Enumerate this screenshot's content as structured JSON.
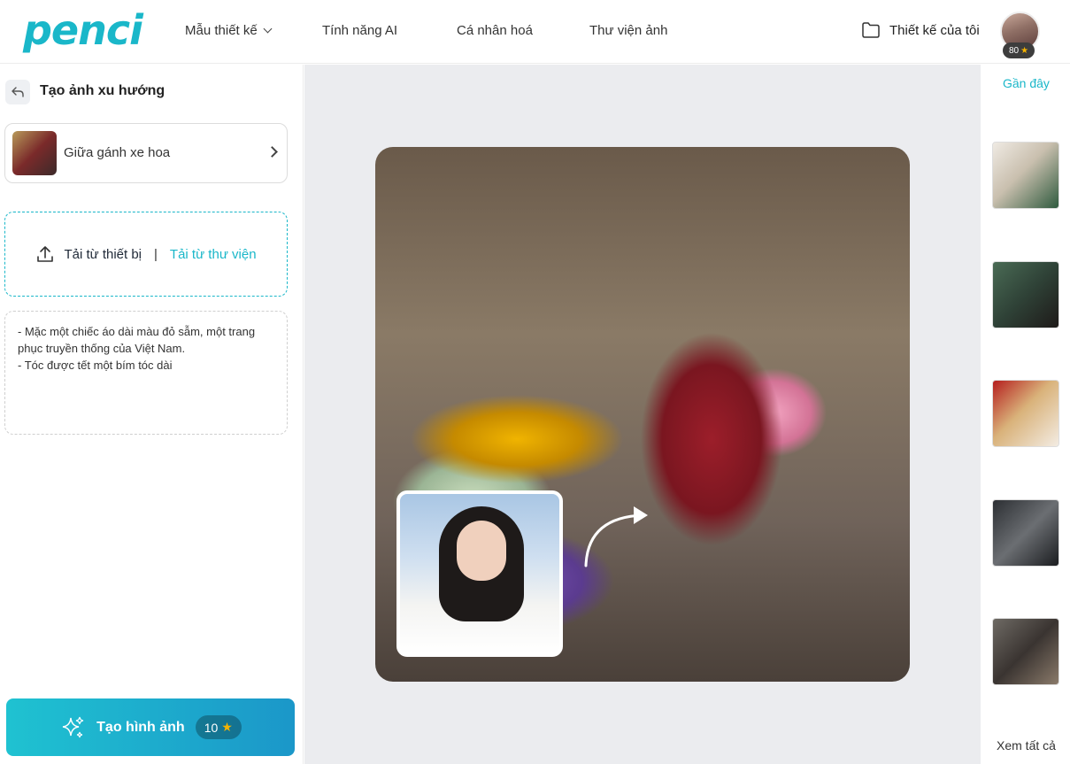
{
  "header": {
    "logo": "penci",
    "nav": [
      {
        "label": "Mẫu thiết kế",
        "has_dropdown": true
      },
      {
        "label": "Tính năng AI"
      },
      {
        "label": "Cá nhân hoá"
      },
      {
        "label": "Thư viện ảnh"
      }
    ],
    "my_designs_label": "Thiết kế của tôi",
    "credits": "80"
  },
  "left_panel": {
    "title": "Tạo ảnh xu hướng",
    "template_name": "Giữa gánh xe hoa",
    "upload_device_label": "Tải từ thiết bị",
    "upload_separator": "|",
    "upload_library_label": "Tải từ thư viện",
    "prompt_text": "- Mặc một chiếc áo dài màu đỏ sẫm, một trang phục truyền thống của Việt Nam.\n- Tóc được tết một bím tóc dài",
    "generate_label": "Tạo hình ảnh",
    "generate_cost": "10"
  },
  "right_panel": {
    "recent_label": "Gần đây",
    "see_all_label": "Xem tất cả",
    "thumbnail_count": 5
  },
  "colors": {
    "accent": "#1ab7c9",
    "button_gradient_start": "#1fc2d1",
    "button_gradient_end": "#1b97c9",
    "canvas_bg": "#ebecef",
    "star": "#f5b300"
  },
  "icons": [
    "chevron-down-icon",
    "folder-icon",
    "star-icon",
    "back-arrow-icon",
    "chevron-right-icon",
    "upload-icon",
    "sparkle-icon",
    "curved-arrow-icon"
  ]
}
